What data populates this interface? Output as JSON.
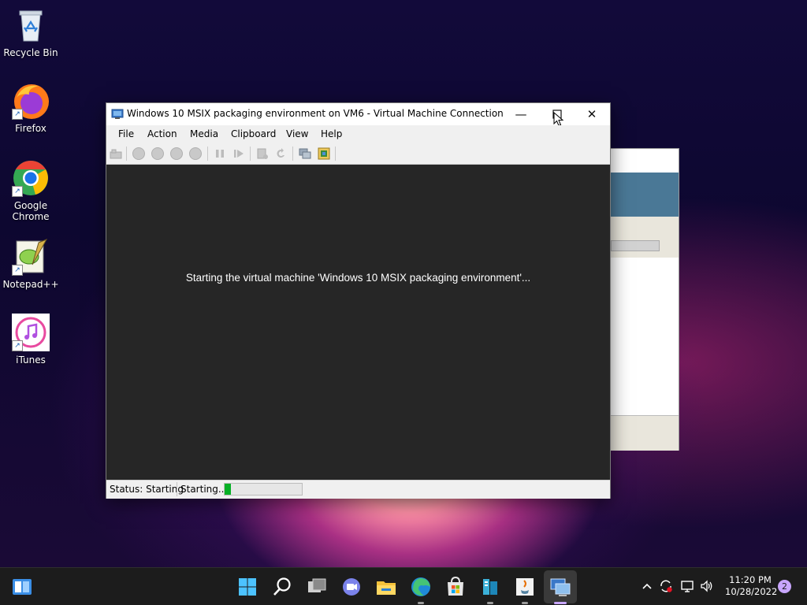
{
  "desktop": {
    "icons": [
      {
        "label": "Recycle Bin",
        "icon": "recycle-bin-icon"
      },
      {
        "label": "Firefox",
        "icon": "firefox-icon"
      },
      {
        "label": "Google Chrome",
        "icon": "chrome-icon"
      },
      {
        "label": "Notepad++",
        "icon": "notepadpp-icon"
      },
      {
        "label": "iTunes",
        "icon": "itunes-icon"
      }
    ]
  },
  "vm_window": {
    "title": "Windows 10 MSIX packaging environment on VM6 - Virtual Machine Connection",
    "menu": [
      "File",
      "Action",
      "Media",
      "Clipboard",
      "View",
      "Help"
    ],
    "screen_message": "Starting the virtual machine 'Windows 10 MSIX packaging environment'...",
    "status": {
      "status_text": "Status: Starting",
      "progress_text": "Starting...",
      "progress_fraction": 0.08
    }
  },
  "taskbar": {
    "apps": [
      "start-icon",
      "search-icon",
      "task-view-icon",
      "teams-chat-icon",
      "file-explorer-icon",
      "edge-icon",
      "store-icon",
      "hyperv-manager-icon",
      "java-icon",
      "vm-connection-icon"
    ],
    "clock": {
      "time": "11:20 PM",
      "date": "10/28/2022"
    },
    "notification_count": "2"
  },
  "colors": {
    "progress_green": "#06b025",
    "vm_screen": "#262626",
    "taskbar": "#1c1c1c"
  }
}
